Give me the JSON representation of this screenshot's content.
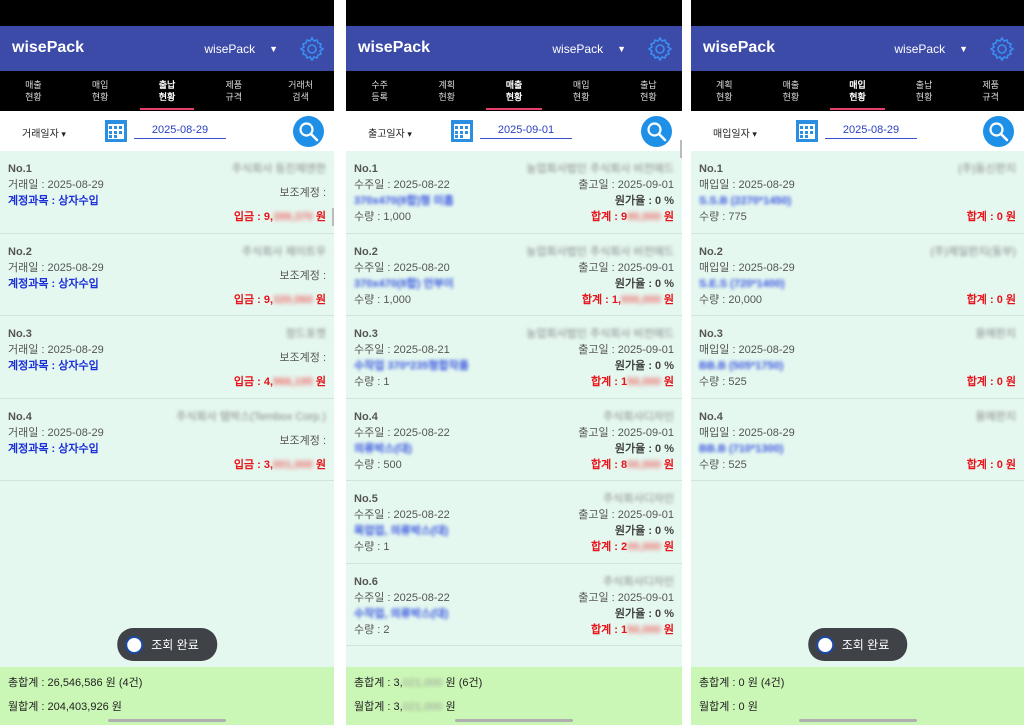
{
  "app_title": "wisePack",
  "account_name": "wisePack",
  "screens": [
    {
      "tabs": [
        {
          "top": "매출",
          "bottom": "현황"
        },
        {
          "top": "매입",
          "bottom": "현황"
        },
        {
          "top": "출납",
          "bottom": "현황"
        },
        {
          "top": "제품",
          "bottom": "규격"
        },
        {
          "top": "거래처",
          "bottom": "검색"
        }
      ],
      "active_tab": 2,
      "date_type": "거래일자",
      "date_value": "2025-08-29",
      "items": [
        {
          "no": "No.1",
          "company": "주식회사 등진제엔한",
          "date": "거래일 : 2025-08-29",
          "aux": "보조계정 :",
          "account": "계정과목 : 상자수입",
          "amount_label": "입금 : 9,",
          "amount_hidden": "399,370",
          "unit": "원"
        },
        {
          "no": "No.2",
          "company": "주식회사 제이트우",
          "date": "거래일 : 2025-08-29",
          "aux": "보조계정 :",
          "account": "계정과목 : 상자수입",
          "amount_label": "입금 : 9,",
          "amount_hidden": "320,060",
          "unit": "원"
        },
        {
          "no": "No.3",
          "company": "정드포켓",
          "date": "거래일 : 2025-08-29",
          "aux": "보조계정 :",
          "account": "계정과목 : 상자수입",
          "amount_label": "입금 : 4,",
          "amount_hidden": "966,195",
          "unit": "원"
        },
        {
          "no": "No.4",
          "company": "주식회사 템박스(Tembox Corp.)",
          "date": "거래일 : 2025-08-29",
          "aux": "보조계정 :",
          "account": "계정과목 : 상자수입",
          "amount_label": "입금 : 3,",
          "amount_hidden": "001,000",
          "unit": "원"
        }
      ],
      "toast": "조회 완료",
      "footer_total": "총합계 : 26,546,586 원 (4건)",
      "footer_month": "월합계 : 204,403,926 원"
    },
    {
      "tabs": [
        {
          "top": "수주",
          "bottom": "등록"
        },
        {
          "top": "계획",
          "bottom": "현황"
        },
        {
          "top": "매출",
          "bottom": "현황"
        },
        {
          "top": "매입",
          "bottom": "현황"
        },
        {
          "top": "출납",
          "bottom": "현황"
        }
      ],
      "active_tab": 2,
      "date_type": "출고일자",
      "date_value": "2025-09-01",
      "items": [
        {
          "no": "No.1",
          "company": "농업회사법인 주식회사 비전에드",
          "order": "수주일 : 2025-08-22",
          "ship": "출고일 : 2025-09-01",
          "product": "370x470(8합)형 미홉",
          "cost": "원가율 : 0 %",
          "qty": "수량 : 1,000",
          "sum_label": "합계 : 9",
          "sum_hidden": "90,000",
          "unit": "원"
        },
        {
          "no": "No.2",
          "company": "농업회사법인 주식회사 비전에드",
          "order": "수주일 : 2025-08-20",
          "ship": "출고일 : 2025-09-01",
          "product": "370x470(8합) 안부이",
          "cost": "원가율 : 0 %",
          "qty": "수량 : 1,000",
          "sum_label": "합계 : 1,",
          "sum_hidden": "000,000",
          "unit": "원"
        },
        {
          "no": "No.3",
          "company": "농업회사법인 주식회사 비전에드",
          "order": "수주일 : 2025-08-21",
          "ship": "출고일 : 2025-09-01",
          "product": "수작업 370*235형합작품",
          "cost": "원가율 : 0 %",
          "qty": "수량 : 1",
          "sum_label": "합계 : 1",
          "sum_hidden": "50,000",
          "unit": "원"
        },
        {
          "no": "No.4",
          "company": "주식회사디자인",
          "order": "수주일 : 2025-08-22",
          "ship": "출고일 : 2025-09-01",
          "product": "의류박스(대)",
          "cost": "원가율 : 0 %",
          "qty": "수량 : 500",
          "sum_label": "합계 : 8",
          "sum_hidden": "00,000",
          "unit": "원"
        },
        {
          "no": "No.5",
          "company": "주식회사디자인",
          "order": "수주일 : 2025-08-22",
          "ship": "출고일 : 2025-09-01",
          "product": "목업업, 의류박스(대)",
          "cost": "원가율 : 0 %",
          "qty": "수량 : 1",
          "sum_label": "합계 : 2",
          "sum_hidden": "00,000",
          "unit": "원"
        },
        {
          "no": "No.6",
          "company": "주식회사디자인",
          "order": "수주일 : 2025-08-22",
          "ship": "출고일 : 2025-09-01",
          "product": "수작업, 의류박스(대)",
          "cost": "원가율 : 0 %",
          "qty": "수량 : 2",
          "sum_label": "합계 : 1",
          "sum_hidden": "50,000",
          "unit": "원"
        }
      ],
      "footer_total_label": "총합계 : 3,",
      "footer_total_hidden": "021,000",
      "footer_total_unit": "원 (6건)",
      "footer_month_label": "월합계 : 3,",
      "footer_month_hidden": "021,000",
      "footer_month_unit": "원"
    },
    {
      "tabs": [
        {
          "top": "계획",
          "bottom": "현황"
        },
        {
          "top": "매출",
          "bottom": "현황"
        },
        {
          "top": "매입",
          "bottom": "현황"
        },
        {
          "top": "출납",
          "bottom": "현황"
        },
        {
          "top": "제품",
          "bottom": "규격"
        }
      ],
      "active_tab": 2,
      "date_type": "매입일자",
      "date_value": "2025-08-29",
      "items": [
        {
          "no": "No.1",
          "company": "(주)동신판지",
          "date": "매입일 : 2025-08-29",
          "product": "S.S.B (2270*1450)",
          "qty": "수량 : 775",
          "sum": "합계 : 0 원"
        },
        {
          "no": "No.2",
          "company": "(주)제일판지(동부)",
          "date": "매입일 : 2025-08-29",
          "product": "S.E.S (720*1400)",
          "qty": "수량 : 20,000",
          "sum": "합계 : 0 원"
        },
        {
          "no": "No.3",
          "company": "용에판지",
          "date": "매입일 : 2025-08-29",
          "product": "BB.B (505*1750)",
          "qty": "수량 : 525",
          "sum": "합계 : 0 원"
        },
        {
          "no": "No.4",
          "company": "용에판지",
          "date": "매입일 : 2025-08-29",
          "product": "BB.B (710*1300)",
          "qty": "수량 : 525",
          "sum": "합계 : 0 원"
        }
      ],
      "toast": "조회 완료",
      "footer_total": "총합계 : 0 원 (4건)",
      "footer_month": "월합계 : 0 원"
    }
  ],
  "icons": {
    "settings": "gear-icon",
    "calendar": "calendar-icon",
    "search": "search-icon",
    "toast": "info-icon",
    "dropdown": "chevron-down-icon"
  },
  "colors": {
    "appbar": "#3c4aa8",
    "tab_indicator": "#e83e6c",
    "list_bg": "#e5f8f0",
    "footer_bg": "#cbf7b6",
    "amount": "#e8121a",
    "account": "#1a2fd8",
    "search_button": "#1e90e8"
  }
}
